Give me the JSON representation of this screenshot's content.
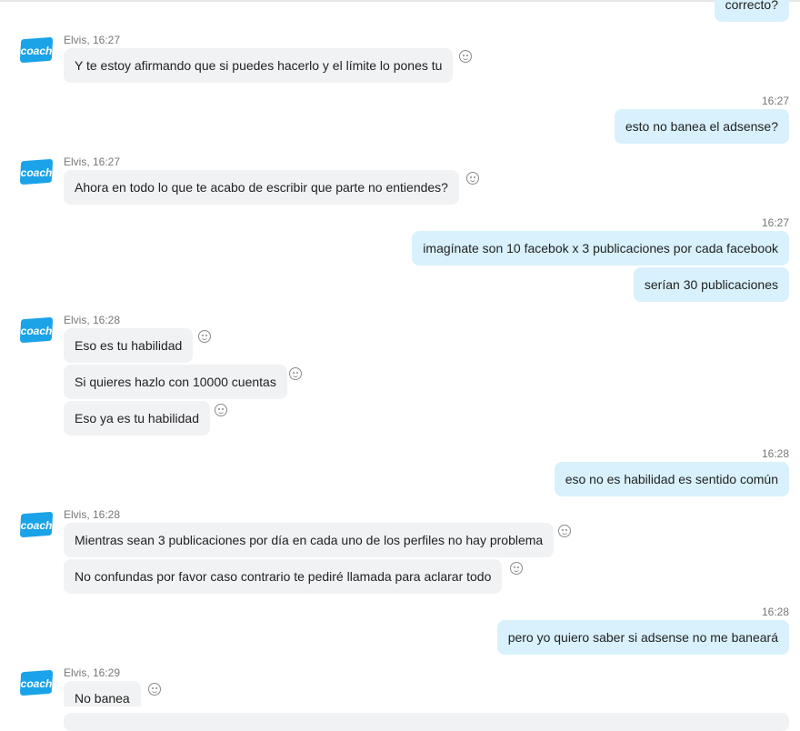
{
  "sender": {
    "name": "Elvis",
    "avatar_text": "coach",
    "avatar_color": "#1aa3e8"
  },
  "colors": {
    "incoming_bubble": "#f1f2f4",
    "outgoing_bubble": "#d8f1fc"
  },
  "messages": {
    "m0": {
      "text": "correcto?"
    },
    "g1": {
      "meta": "Elvis, 16:27",
      "m1": "Y te estoy afirmando que si puedes hacerlo y el límite lo pones tu"
    },
    "o1": {
      "time": "16:27",
      "m1": "esto no banea el adsense?"
    },
    "g2": {
      "meta": "Elvis, 16:27",
      "m1": "Ahora en todo lo que te acabo de escribir que parte no entiendes?"
    },
    "o2": {
      "time": "16:27",
      "m1": "imagínate son 10 facebok x 3 publicaciones por cada facebook",
      "m2": "serían 30 publicaciones"
    },
    "g3": {
      "meta": "Elvis, 16:28",
      "m1": "Eso es tu habilidad",
      "m2": "Si quieres hazlo con 10000 cuentas",
      "m3": "Eso ya es tu habilidad"
    },
    "o3": {
      "time": "16:28",
      "m1": "eso no es habilidad es sentido común"
    },
    "g4": {
      "meta": "Elvis, 16:28",
      "m1": "Mientras sean 3 publicaciones por día en cada uno de los perfiles no hay problema",
      "m2": "No confundas por favor caso contrario te pediré llamada para aclarar todo"
    },
    "o4": {
      "time": "16:28",
      "m1": "pero yo quiero saber si adsense no me baneará"
    },
    "g5": {
      "meta": "Elvis, 16:29",
      "m1": "No banea"
    }
  }
}
